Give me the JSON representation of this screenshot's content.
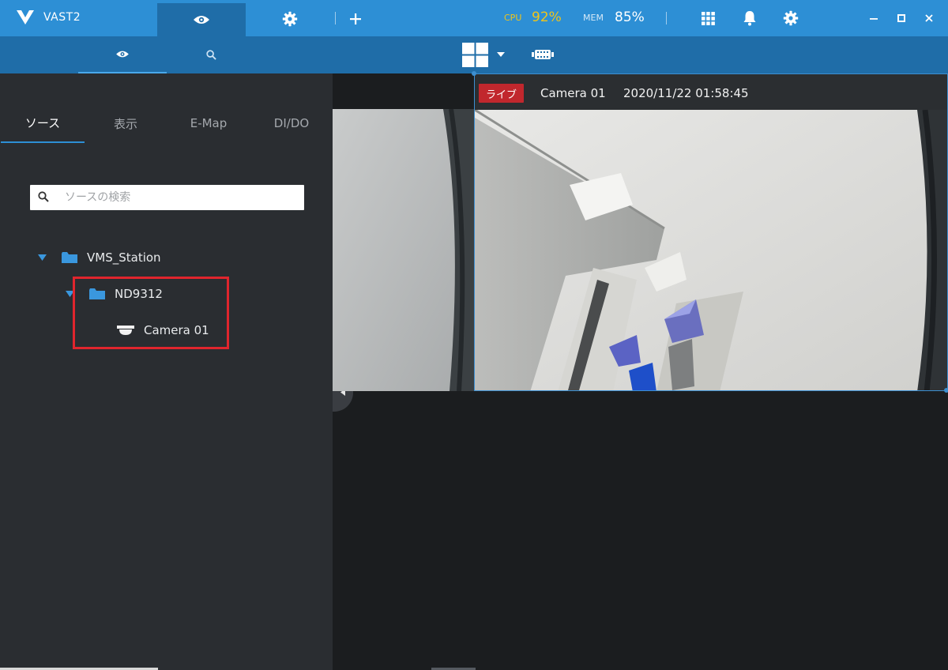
{
  "app": {
    "title": "VAST2"
  },
  "titlebar": {
    "icons": [
      "eye-icon",
      "gear-icon",
      "plus-icon",
      "grid-icon",
      "bell-icon",
      "gear-icon",
      "minimize-icon",
      "maximize-icon",
      "close-icon"
    ],
    "cpu_label": "CPU",
    "cpu_value": "92%",
    "mem_label": "MEM",
    "mem_value": "85%",
    "cpu_color": "#f0c419",
    "mem_color": "#ffffff"
  },
  "toolbar": {
    "side_tabs": [
      "eye-icon",
      "search-icon"
    ],
    "layout_icon": "layout-grid-icon",
    "fisheye_icon": "film-icon"
  },
  "sidebar": {
    "tabs": [
      {
        "label": "ソース",
        "active": true
      },
      {
        "label": "表示",
        "active": false
      },
      {
        "label": "E-Map",
        "active": false
      },
      {
        "label": "DI/DO",
        "active": false
      }
    ],
    "search": {
      "placeholder": "ソースの検索",
      "value": ""
    },
    "tree": [
      {
        "label": "VMS_Station",
        "type": "folder",
        "level": 0,
        "expanded": true
      },
      {
        "label": "ND9312",
        "type": "folder",
        "level": 1,
        "expanded": true
      },
      {
        "label": "Camera 01",
        "type": "camera",
        "level": 2
      }
    ]
  },
  "view": {
    "live_label": "ライブ",
    "camera_name": "Camera 01",
    "timestamp": "2020/11/22 01:58:45"
  },
  "colors": {
    "accent": "#2d8fd5",
    "toolbar": "#1f6da8",
    "live_badge": "#c1272d",
    "highlight": "#e0252d"
  }
}
